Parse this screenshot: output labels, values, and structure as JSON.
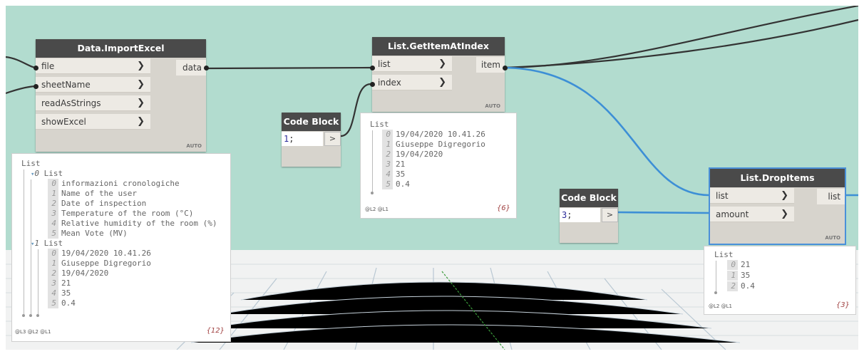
{
  "nodes": {
    "import_excel": {
      "title": "Data.ImportExcel",
      "inputs": [
        "file",
        "sheetName",
        "readAsStrings",
        "showExcel"
      ],
      "output": "data",
      "lacing": "AUTO"
    },
    "get_item": {
      "title": "List.GetItemAtIndex",
      "inputs": [
        "list",
        "index"
      ],
      "output": "item",
      "lacing": "AUTO"
    },
    "drop_items": {
      "title": "List.DropItems",
      "inputs": [
        "list",
        "amount"
      ],
      "output": "list",
      "lacing": "AUTO"
    },
    "code_block_1": {
      "title": "Code Block",
      "value": "1",
      "semicolon": ";",
      "out": ">"
    },
    "code_block_3": {
      "title": "Code Block",
      "value": "3",
      "semicolon": ";",
      "out": ">"
    }
  },
  "watch_import": {
    "root": "List",
    "group0": {
      "label": "List",
      "index": "0",
      "items": [
        {
          "i": "0",
          "v": "informazioni cronologiche"
        },
        {
          "i": "1",
          "v": "Name of the user"
        },
        {
          "i": "2",
          "v": "Date of inspection"
        },
        {
          "i": "3",
          "v": "Temperature of the room (°C)"
        },
        {
          "i": "4",
          "v": "Relative humidity of the room (%)"
        },
        {
          "i": "5",
          "v": "Mean Vote (MV)"
        }
      ]
    },
    "group1": {
      "label": "List",
      "index": "1",
      "items": [
        {
          "i": "0",
          "v": "19/04/2020 10.41.26"
        },
        {
          "i": "1",
          "v": "Giuseppe Digregorio"
        },
        {
          "i": "2",
          "v": "19/04/2020"
        },
        {
          "i": "3",
          "v": "21"
        },
        {
          "i": "4",
          "v": "35"
        },
        {
          "i": "5",
          "v": "0.4"
        }
      ]
    },
    "levels": "@L3 @L2 @L1",
    "count": "{12}"
  },
  "watch_get": {
    "root": "List",
    "items": [
      {
        "i": "0",
        "v": "19/04/2020 10.41.26"
      },
      {
        "i": "1",
        "v": "Giuseppe Digregorio"
      },
      {
        "i": "2",
        "v": "19/04/2020"
      },
      {
        "i": "3",
        "v": "21"
      },
      {
        "i": "4",
        "v": "35"
      },
      {
        "i": "5",
        "v": "0.4"
      }
    ],
    "levels": "@L2 @L1",
    "count": "{6}"
  },
  "watch_drop": {
    "root": "List",
    "items": [
      {
        "i": "0",
        "v": "21"
      },
      {
        "i": "1",
        "v": "35"
      },
      {
        "i": "2",
        "v": "0.4"
      }
    ],
    "levels": "@L2 @L1",
    "count": "{3}"
  },
  "colors": {
    "canvas": "#b2dccf",
    "node_body": "#d7d4cd",
    "node_header": "#4a4a4a",
    "wire": "#333333",
    "wire_selected": "#3d8fd6"
  },
  "icons": [
    "chevron-right-icon",
    "output-port-icon"
  ]
}
